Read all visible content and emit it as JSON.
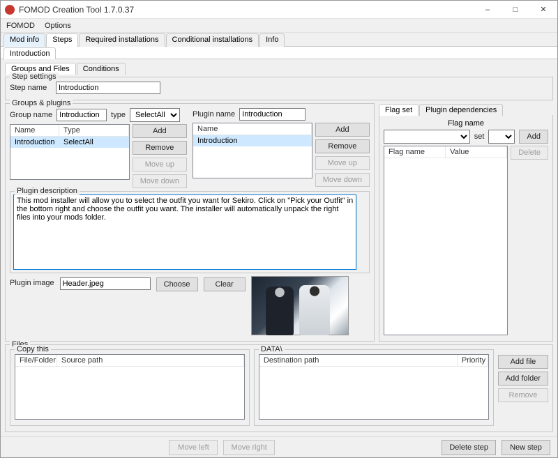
{
  "window": {
    "title": "FOMOD Creation Tool 1.7.0.37"
  },
  "menubar": {
    "fomod": "FOMOD",
    "options": "Options"
  },
  "main_tabs": {
    "mod_info": "Mod info",
    "steps": "Steps",
    "required": "Required installations",
    "conditional": "Conditional installations",
    "info": "Info"
  },
  "sub_tab": {
    "introduction": "Introduction"
  },
  "gc_tabs": {
    "groups_files": "Groups and Files",
    "conditions": "Conditions"
  },
  "step_settings": {
    "legend": "Step settings",
    "step_name_label": "Step name",
    "step_name_value": "Introduction"
  },
  "groups_plugins": {
    "legend": "Groups & plugins",
    "group_name_label": "Group name",
    "group_name_value": "Introduction",
    "type_label": "type",
    "type_value": "SelectAll",
    "group_table": {
      "col_name": "Name",
      "col_type": "Type",
      "rows": [
        {
          "name": "Introduction",
          "type": "SelectAll"
        }
      ]
    },
    "group_buttons": {
      "add": "Add",
      "remove": "Remove",
      "moveup": "Move up",
      "movedown": "Move down"
    },
    "plugin_name_label": "Plugin name",
    "plugin_name_value": "Introduction",
    "plugin_table": {
      "col_name": "Name",
      "rows": [
        {
          "name": "Introduction"
        }
      ]
    },
    "plugin_buttons": {
      "add": "Add",
      "remove": "Remove",
      "moveup": "Move up",
      "movedown": "Move down"
    }
  },
  "flag_tabs": {
    "flag_set": "Flag set",
    "plugin_deps": "Plugin dependencies"
  },
  "flag_panel": {
    "flag_name_label": "Flag name",
    "set_label": "set",
    "buttons": {
      "add": "Add",
      "delete": "Delete"
    },
    "cols": {
      "name": "Flag name",
      "value": "Value"
    }
  },
  "plugin_desc": {
    "legend": "Plugin description",
    "text": "This mod installer will allow you to select the outfit you want for Sekiro. Click on \"Pick your Outfit\" in the bottom right and choose the outfit you want. The installer will automatically unpack the right files into your mods folder."
  },
  "plugin_image": {
    "label": "Plugin image",
    "value": "Header.jpeg",
    "choose": "Choose",
    "clear": "Clear"
  },
  "files": {
    "legend": "Files",
    "copy_legend": "Copy this",
    "data_legend": "DATA\\",
    "copy_cols": {
      "filefolder": "File/Folder",
      "source": "Source path"
    },
    "data_cols": {
      "dest": "Destination path",
      "priority": "Priority"
    },
    "buttons": {
      "add_file": "Add file",
      "add_folder": "Add folder",
      "remove": "Remove"
    }
  },
  "footer": {
    "move_left": "Move left",
    "move_right": "Move right",
    "delete_step": "Delete step",
    "new_step": "New step"
  }
}
